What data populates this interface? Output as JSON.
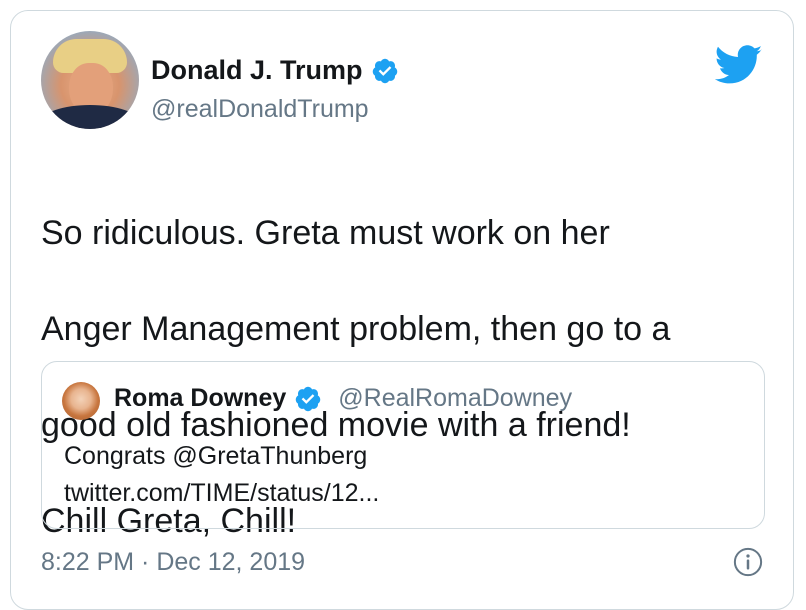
{
  "author": {
    "display_name": "Donald J. Trump",
    "handle": "@realDonaldTrump",
    "verified": true
  },
  "tweet": {
    "lines": [
      "So ridiculous. Greta must work on her",
      "Anger Management problem, then go to a",
      "good old fashioned movie with a friend!",
      "Chill Greta, Chill!"
    ]
  },
  "quoted_tweet": {
    "display_name": "Roma Downey",
    "handle": "@RealRomaDowney",
    "verified": true,
    "text_line1": "Congrats @GretaThunberg",
    "text_line2": "twitter.com/TIME/status/12..."
  },
  "footer": {
    "timestamp": "8:22 PM · Dec 12, 2019"
  },
  "icons": {
    "brand": "twitter-bird-icon",
    "verified": "verified-badge-icon",
    "info": "info-icon"
  },
  "colors": {
    "twitter_blue": "#1da1f2",
    "text": "#14171a",
    "secondary": "#657786",
    "border": "#cfd9de"
  }
}
